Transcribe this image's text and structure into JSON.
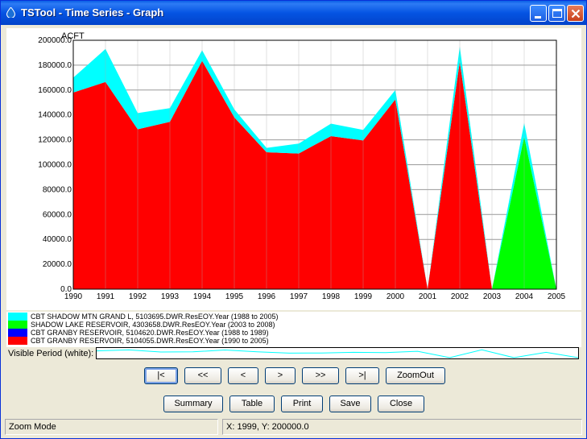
{
  "window": {
    "title": "TSTool - Time Series - Graph",
    "app_icon": "droplet-icon",
    "controls": [
      "minimize-icon",
      "maximize-icon",
      "close-icon"
    ]
  },
  "chart_data": {
    "type": "area",
    "stacked": true,
    "ylabel": "ACFT",
    "ylim": [
      0,
      200000
    ],
    "xlim": [
      1990,
      2005
    ],
    "y_ticks": [
      "0.0",
      "20000.0",
      "40000.0",
      "60000.0",
      "80000.0",
      "100000.0",
      "120000.0",
      "140000.0",
      "160000.0",
      "180000.0",
      "200000.0"
    ],
    "x_ticks": [
      "1990",
      "1991",
      "1992",
      "1993",
      "1994",
      "1995",
      "1996",
      "1997",
      "1998",
      "1999",
      "2000",
      "2001",
      "2002",
      "2003",
      "2004",
      "2005"
    ],
    "grid": true,
    "x": [
      1990,
      1991,
      1992,
      1993,
      1994,
      1995,
      1996,
      1997,
      1998,
      1999,
      2000,
      2001,
      2002,
      2003,
      2004,
      2005
    ],
    "series": [
      {
        "name": "CBT GRANBY RESERVOIR, 5104055.DWR.ResEOY.Year (1990 to 2005)",
        "color": "#ff0000",
        "step": false,
        "values": [
          158000,
          166500,
          128500,
          134500,
          183500,
          138000,
          110000,
          109000,
          123000,
          119500,
          152500,
          0,
          183000,
          0,
          0,
          0
        ]
      },
      {
        "name": "CBT GRANBY RESERVOIR, 5104620.DWR.ResEOY.Year (1988 to 1989)",
        "color": "#0000ff",
        "step": false,
        "values": [
          0,
          0,
          0,
          0,
          0,
          0,
          0,
          0,
          0,
          0,
          0,
          0,
          0,
          0,
          0,
          0
        ]
      },
      {
        "name": "SHADOW LAKE RESERVOIR, 4303658.DWR.ResEOY.Year (2003 to 2008)",
        "color": "#00ff00",
        "step": false,
        "values": [
          0,
          0,
          0,
          0,
          0,
          0,
          0,
          0,
          0,
          0,
          0,
          0,
          0,
          0,
          122500,
          0
        ]
      },
      {
        "name": "CBT SHADOW MTN GRAND L, 5103695.DWR.ResEOY.Year (1988 to 2005)",
        "color": "#00ffff",
        "step": false,
        "values": [
          12000,
          26500,
          13000,
          11000,
          8500,
          6500,
          3500,
          8000,
          10000,
          8500,
          7500,
          0,
          12000,
          0,
          11000,
          0
        ]
      }
    ],
    "legend_order": [
      {
        "name": "CBT SHADOW MTN GRAND L, 5103695.DWR.ResEOY.Year (1988 to 2005)",
        "color": "#00ffff"
      },
      {
        "name": "SHADOW LAKE RESERVOIR, 4303658.DWR.ResEOY.Year (2003 to 2008)",
        "color": "#00ff00"
      },
      {
        "name": "CBT GRANBY RESERVOIR, 5104620.DWR.ResEOY.Year (1988 to 1989)",
        "color": "#0000ff"
      },
      {
        "name": "CBT GRANBY RESERVOIR, 5104055.DWR.ResEOY.Year (1990 to 2005)",
        "color": "#ff0000"
      }
    ],
    "legend_position": "bottom-left"
  },
  "visible_period": {
    "label": "Visible Period (white):"
  },
  "nav_buttons": {
    "first": "|<",
    "back_page": "<<",
    "back": "<",
    "forward": ">",
    "forward_page": ">>",
    "last": ">|",
    "zoom_out": "ZoomOut"
  },
  "action_buttons": {
    "summary": "Summary",
    "table": "Table",
    "print": "Print",
    "save": "Save",
    "close": "Close"
  },
  "status": {
    "mode": "Zoom Mode",
    "coords": "X:  1999,  Y:  200000.0"
  }
}
